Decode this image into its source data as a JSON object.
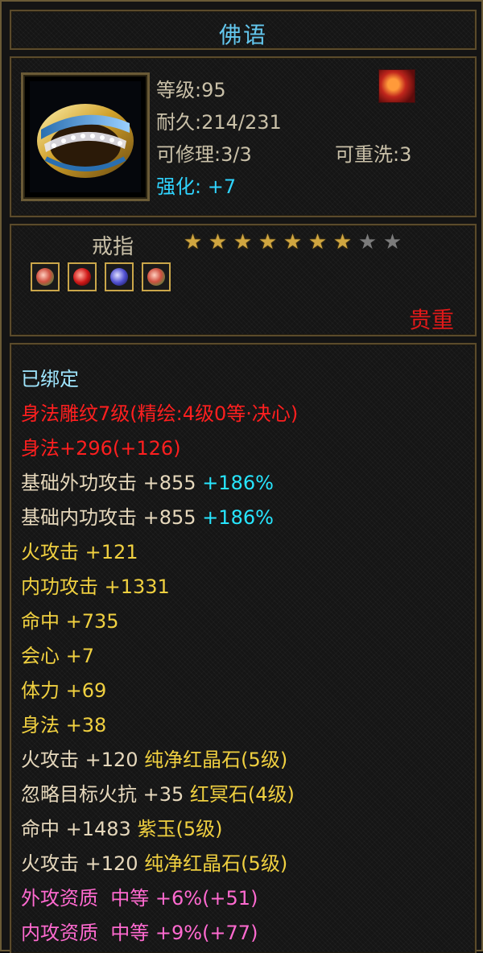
{
  "tooltip": {
    "title": "佛语",
    "level_label": "等级:95",
    "durability_label": "耐久:214/231",
    "repair_label": "可修理:3/3",
    "rewash_label": "可重洗:3",
    "strength_label": "强化: +7",
    "item_type": "戒指",
    "stars_filled": 7,
    "stars_total": 9,
    "rarity": "贵重",
    "bound_status": "已绑定",
    "engraving": "身法雕纹7级(精绘:4级0等·决心)",
    "engrave_bonus": "身法+296(+126)",
    "base_outer_attack": "基础外功攻击 +855",
    "base_outer_pct": "+186%",
    "base_inner_attack": "基础内功攻击 +855",
    "base_inner_pct": "+186%",
    "stats": [
      "火攻击 +121",
      "内功攻击 +1331",
      "命中 +735",
      "会心 +7",
      "体力 +69",
      "身法 +38"
    ],
    "gem_stats": [
      {
        "stat": "火攻击 +120",
        "gem": "纯净红晶石(5级)"
      },
      {
        "stat": "忽略目标火抗 +35",
        "gem": "红冥石(4级)"
      },
      {
        "stat": "命中 +1483",
        "gem": "紫玉(5级)"
      },
      {
        "stat": "火攻击 +120",
        "gem": "纯净红晶石(5级)"
      }
    ],
    "aptitudes": [
      "外攻资质  中等 +6%(+51)",
      "内攻资质  中等 +9%(+77)"
    ],
    "socket_gems": [
      "green-red gem",
      "red gem",
      "purple gem",
      "green-red gem"
    ],
    "colors": {
      "title": "#63c7ee",
      "rarity": "#e01919",
      "engrave": "#ff1f1f",
      "stat": "#f0d040",
      "percent": "#27e6ff",
      "aptitude": "#ff6ad0"
    }
  }
}
